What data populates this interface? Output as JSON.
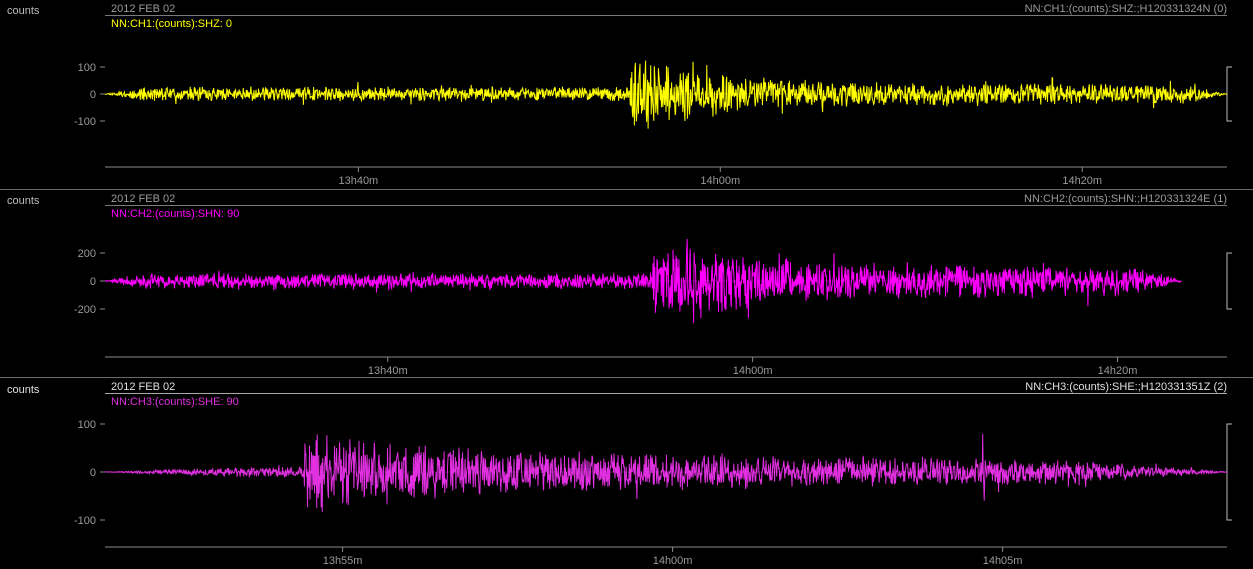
{
  "chart_data": [
    {
      "type": "line",
      "units_label": "counts",
      "date_label": "2012 FEB 02",
      "station_label": "NN:CH1:(counts):SHZ:;H120331324N (0)",
      "channel_label": "NN:CH1:(counts):SHZ: 0",
      "color": "#ffff00",
      "ylabels": [
        "100",
        "0",
        "-100"
      ],
      "yticks": [
        100,
        0,
        -100
      ],
      "ylim": [
        -145,
        145
      ],
      "xlabels": [
        "13h40m",
        "14h00m",
        "14h20m"
      ],
      "xlim_minutes": [
        0,
        62
      ],
      "xticks_minutes": [
        14,
        34,
        54
      ],
      "signal": {
        "seed": 11,
        "start": 0,
        "end": 62,
        "base": 28,
        "events": [
          {
            "t": 29,
            "amp": 120,
            "decay": 5
          }
        ],
        "late_env": 40,
        "spikes": [
          [
            52.3,
            -30
          ],
          [
            52.35,
            60
          ]
        ]
      }
    },
    {
      "type": "line",
      "units_label": "counts",
      "date_label": "2012 FEB 02",
      "station_label": "NN:CH2:(counts):SHN:;H120331324E (1)",
      "channel_label": "NN:CH2:(counts):SHN: 90",
      "color": "#ff00ff",
      "ylabels": [
        "200",
        "0",
        "-200"
      ],
      "yticks": [
        200,
        0,
        -200
      ],
      "ylim": [
        -300,
        300
      ],
      "xlabels": [
        "13h40m",
        "14h00m",
        "14h20m"
      ],
      "xlim_minutes": [
        0,
        61.5
      ],
      "xticks_minutes": [
        15.5,
        35.5,
        55.5
      ],
      "signal": {
        "seed": 22,
        "start": 0,
        "end": 59,
        "base": 60,
        "events": [
          {
            "t": 30,
            "amp": 230,
            "decay": 7
          }
        ],
        "late_env": 110,
        "spikes": []
      }
    },
    {
      "type": "line",
      "units_label": "counts",
      "date_label": "2012 FEB 02",
      "station_label": "NN:CH3:(counts):SHE:;H120331351Z (2)",
      "channel_label": "NN:CH3:(counts):SHE: 90",
      "color": "#e030e0",
      "ylabels": [
        "100",
        "0",
        "-100"
      ],
      "yticks": [
        100,
        0,
        -100
      ],
      "ylim": [
        -105,
        105
      ],
      "xlabels": [
        "13h55m",
        "14h00m",
        "14h05m"
      ],
      "xlim_minutes": [
        0,
        17
      ],
      "xticks_minutes": [
        3.6,
        8.6,
        13.6
      ],
      "signal": {
        "seed": 33,
        "start": 0,
        "end": 17,
        "base": 12,
        "events": [
          {
            "t": 3.0,
            "amp": 80,
            "decay": 2.6
          }
        ],
        "late_env": 30,
        "spikes": [
          [
            13.3,
            80
          ],
          [
            13.32,
            -60
          ],
          [
            6.3,
            40
          ]
        ]
      }
    }
  ]
}
